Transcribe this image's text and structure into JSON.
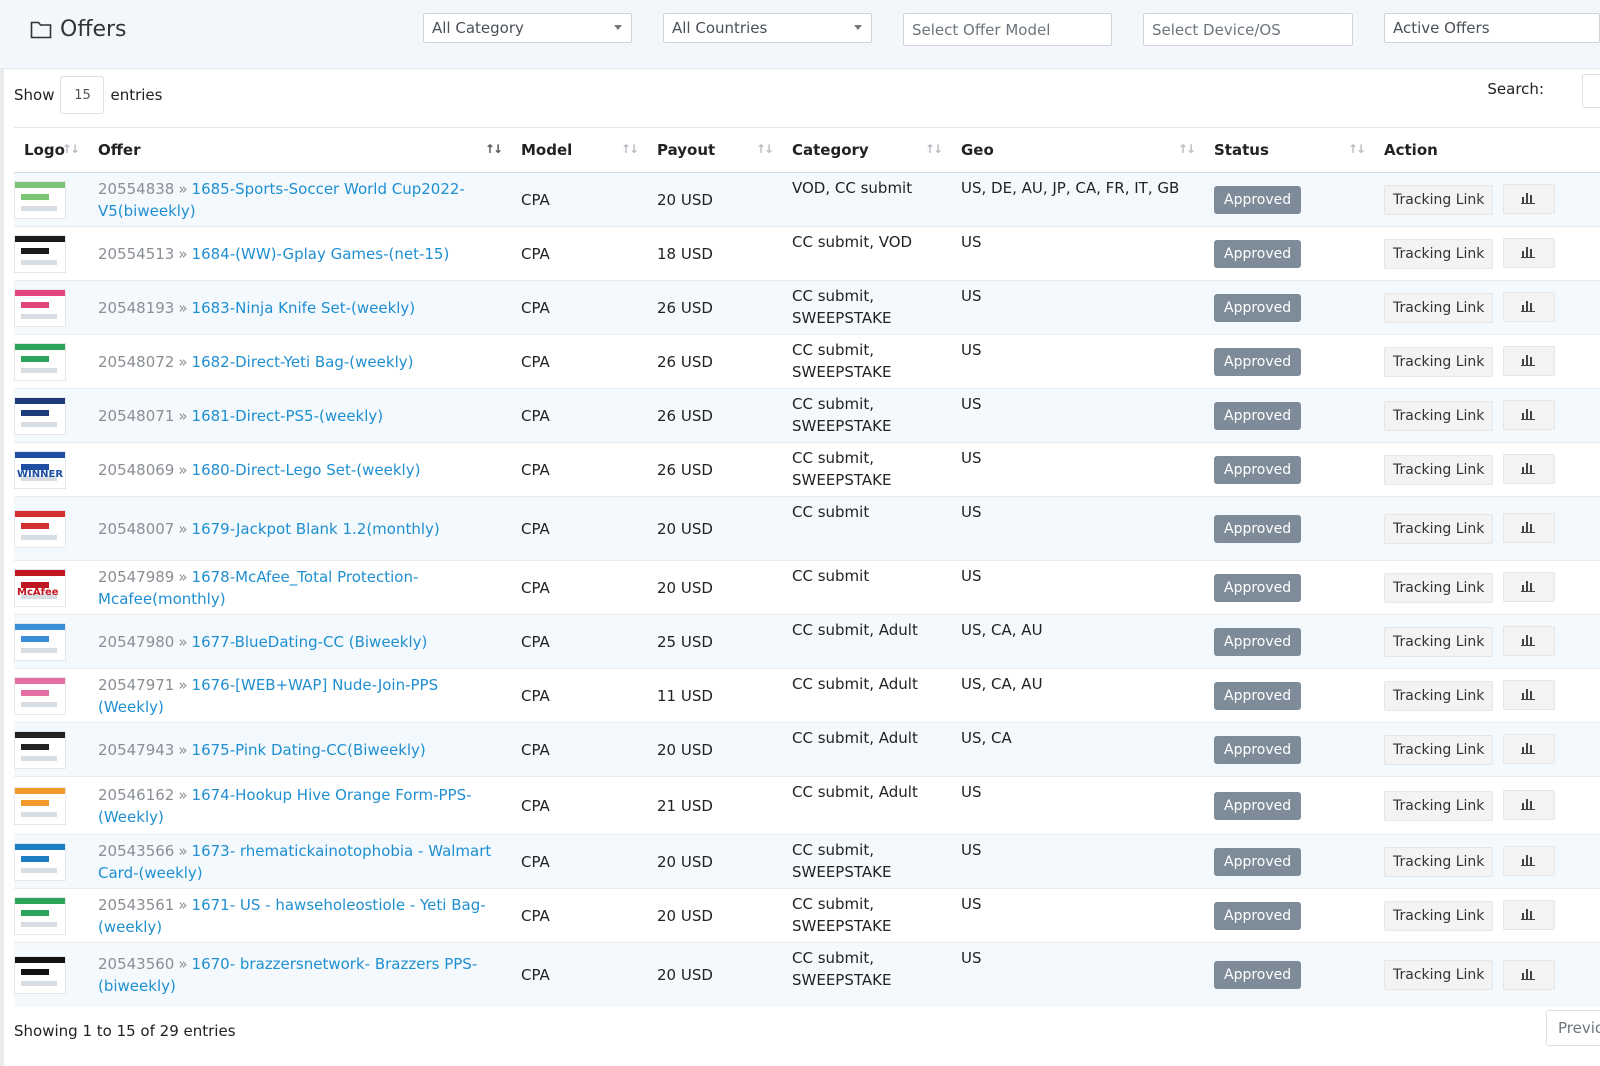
{
  "header": {
    "title": "Offers",
    "filters": {
      "category": "All Category",
      "countries": "All Countries",
      "offer_model": "Select Offer Model",
      "device": "Select Device/OS",
      "status": "Active Offers"
    }
  },
  "length": {
    "show_label": "Show",
    "value": "15",
    "entries_label": "entries"
  },
  "search_label": "Search:",
  "columns": [
    "Logo",
    "Offer",
    "Model",
    "Payout",
    "Category",
    "Geo",
    "Status",
    "Action"
  ],
  "rows": [
    {
      "id": "20554838",
      "name": "1685-Sports-Soccer World Cup2022-V5(biweekly)",
      "model": "CPA",
      "payout": "20 USD",
      "category": "VOD, CC submit",
      "geo": "US, DE, AU, JP, CA, FR, IT, GB",
      "status": "Approved",
      "action": "Tracking Link",
      "logo_color": "#7cc576"
    },
    {
      "id": "20554513",
      "name": "1684-(WW)-Gplay Games-(net-15)",
      "model": "CPA",
      "payout": "18 USD",
      "category": "CC submit, VOD",
      "geo": "US",
      "status": "Approved",
      "action": "Tracking Link",
      "logo_color": "#1b1b1b"
    },
    {
      "id": "20548193",
      "name": "1683-Ninja Knife Set-(weekly)",
      "model": "CPA",
      "payout": "26 USD",
      "category": "CC submit, SWEEPSTAKE",
      "geo": "US",
      "status": "Approved",
      "action": "Tracking Link",
      "logo_color": "#e0457b"
    },
    {
      "id": "20548072",
      "name": "1682-Direct-Yeti Bag-(weekly)",
      "model": "CPA",
      "payout": "26 USD",
      "category": "CC submit, SWEEPSTAKE",
      "geo": "US",
      "status": "Approved",
      "action": "Tracking Link",
      "logo_color": "#2ca55a"
    },
    {
      "id": "20548071",
      "name": "1681-Direct-PS5-(weekly)",
      "model": "CPA",
      "payout": "26 USD",
      "category": "CC submit, SWEEPSTAKE",
      "geo": "US",
      "status": "Approved",
      "action": "Tracking Link",
      "logo_color": "#1d3a7a"
    },
    {
      "id": "20548069",
      "name": "1680-Direct-Lego Set-(weekly)",
      "model": "CPA",
      "payout": "26 USD",
      "category": "CC submit, SWEEPSTAKE",
      "geo": "US",
      "status": "Approved",
      "action": "Tracking Link",
      "logo_color": "#1e4fa3",
      "logo_text": "WINNER"
    },
    {
      "id": "20548007",
      "name": "1679-Jackpot Blank 1.2(monthly)",
      "model": "CPA",
      "payout": "20 USD",
      "category": "CC submit",
      "geo": "US",
      "status": "Approved",
      "action": "Tracking Link",
      "logo_color": "#d32f2f"
    },
    {
      "id": "20547989",
      "name": "1678-McAfee_Total Protection-Mcafee(monthly)",
      "model": "CPA",
      "payout": "20 USD",
      "category": "CC submit",
      "geo": "US",
      "status": "Approved",
      "action": "Tracking Link",
      "logo_color": "#c0161f",
      "logo_text": "McAfee"
    },
    {
      "id": "20547980",
      "name": "1677-BlueDating-CC (Biweekly)",
      "model": "CPA",
      "payout": "25 USD",
      "category": "CC submit, Adult",
      "geo": "US, CA, AU",
      "status": "Approved",
      "action": "Tracking Link",
      "logo_color": "#3a8fd8"
    },
    {
      "id": "20547971",
      "name": "1676-[WEB+WAP] Nude-Join-PPS (Weekly)",
      "model": "CPA",
      "payout": "11 USD",
      "category": "CC submit, Adult",
      "geo": "US, CA, AU",
      "status": "Approved",
      "action": "Tracking Link",
      "logo_color": "#e36fa5"
    },
    {
      "id": "20547943",
      "name": "1675-Pink Dating-CC(Biweekly)",
      "model": "CPA",
      "payout": "20 USD",
      "category": "CC submit, Adult",
      "geo": "US, CA",
      "status": "Approved",
      "action": "Tracking Link",
      "logo_color": "#222222"
    },
    {
      "id": "20546162",
      "name": "1674-Hookup Hive Orange Form-PPS-(Weekly)",
      "model": "CPA",
      "payout": "21 USD",
      "category": "CC submit, Adult",
      "geo": "US",
      "status": "Approved",
      "action": "Tracking Link",
      "logo_color": "#f19a2a"
    },
    {
      "id": "20543566",
      "name": "1673- rhematickainotophobia - Walmart Card-(weekly)",
      "model": "CPA",
      "payout": "20 USD",
      "category": "CC submit, SWEEPSTAKE",
      "geo": "US",
      "status": "Approved",
      "action": "Tracking Link",
      "logo_color": "#1c7fc4"
    },
    {
      "id": "20543561",
      "name": "1671- US - hawseholeostiole - Yeti Bag-(weekly)",
      "model": "CPA",
      "payout": "20 USD",
      "category": "CC submit, SWEEPSTAKE",
      "geo": "US",
      "status": "Approved",
      "action": "Tracking Link",
      "logo_color": "#2ca55a"
    },
    {
      "id": "20543560",
      "name": "1670- brazzersnetwork- Brazzers PPS-(biweekly)",
      "model": "CPA",
      "payout": "20 USD",
      "category": "CC submit, SWEEPSTAKE",
      "geo": "US",
      "status": "Approved",
      "action": "Tracking Link",
      "logo_color": "#111111"
    }
  ],
  "footer": {
    "info": "Showing 1 to 15 of 29 entries",
    "prev": "Previo"
  }
}
